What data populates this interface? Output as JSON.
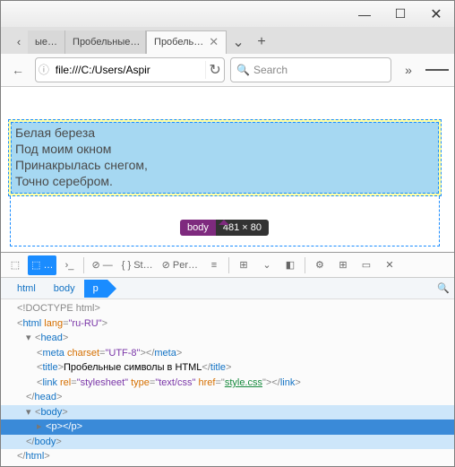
{
  "window": {
    "minimize": "—",
    "maximize": "☐",
    "close": "✕"
  },
  "tabs": {
    "back": "‹",
    "items": [
      {
        "label": "ые…"
      },
      {
        "label": "Пробельные…"
      },
      {
        "label": "Пробель…",
        "active": true
      }
    ],
    "dropdown": "⌄",
    "new": "+"
  },
  "nav": {
    "back": "←",
    "info": "ⓘ",
    "url_value": "file:///C:/Users/Aspir",
    "reload": "↻",
    "search_icon": "🔍",
    "search_placeholder": "Search",
    "overflow": "»",
    "menu": "≡"
  },
  "page": {
    "lines": [
      "Белая береза",
      "Под моим окном",
      "Принакрылась снегом,",
      "Точно серебром."
    ],
    "badge_tag": "body",
    "badge_dim": "481 × 80"
  },
  "devtools": {
    "toolbar": {
      "pick": "⬚",
      "inspector": "⬚ …",
      "console": "›_",
      "debugger": "⊘ —",
      "style": "{ } St…",
      "perf": "⊘ Per…",
      "more1": "≡",
      "more2": "⊞",
      "more3": "⌄",
      "more4": "◧",
      "settings": "⚙",
      "panels": "⊞",
      "dock": "▭",
      "close": "✕"
    },
    "breadcrumb": {
      "html": "html",
      "body": "body",
      "p": "p"
    },
    "search_icon": "🔍",
    "dom": {
      "doctype": "<!DOCTYPE html>",
      "html_open": "html",
      "lang_attr": "lang",
      "lang_val": "\"ru-RU\"",
      "head": "head",
      "meta": "meta",
      "charset_attr": "charset",
      "charset_val": "\"UTF-8\"",
      "title": "title",
      "title_text": "Пробельные символы в HTML",
      "link": "link",
      "rel_attr": "rel",
      "rel_val": "\"stylesheet\"",
      "type_attr": "type",
      "type_val": "\"text/css\"",
      "href_attr": "href",
      "href_val": "style.css",
      "body": "body",
      "p": "p"
    }
  }
}
